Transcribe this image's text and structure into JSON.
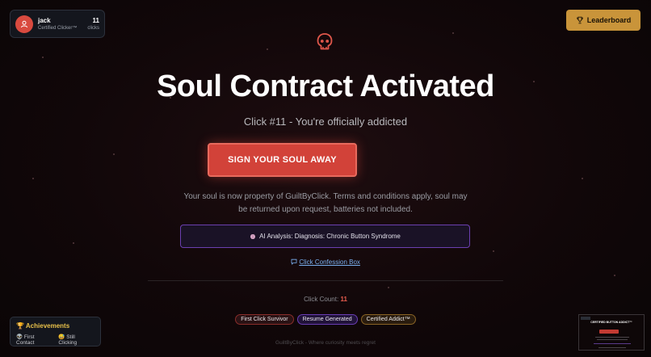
{
  "user": {
    "name": "jack",
    "title": "Certified Clicker™",
    "clicks": "11",
    "clicks_label": "clicks"
  },
  "leaderboard": {
    "label": "Leaderboard"
  },
  "main": {
    "headline": "Soul Contract Activated",
    "subline": "Click #11 - You're officially addicted",
    "cta_label": "SIGN YOUR SOUL AWAY",
    "description": "Your soul is now property of GuiltByClick. Terms and conditions apply, soul may be returned upon request, batteries not included.",
    "ai_analysis": "AI Analysis: Diagnosis: Chronic Button Syndrome",
    "confession_link": "Click Confession Box",
    "count_label": "Click Count:",
    "count_value": "11",
    "badges": [
      "First Click Survivor",
      "Resume Generated",
      "Certified Addict™"
    ],
    "footer": "GuiltByClick - Where curiosity meets regret"
  },
  "achievements": {
    "title": "Achievements",
    "items": [
      "First Contact",
      "Still Clicking"
    ]
  },
  "thumbnail": {
    "title": "CERTIFIED BUTTON ADDICT™"
  },
  "colors": {
    "accent_red": "#d24239",
    "gold": "#c9943a",
    "purple": "#6b3fb0",
    "link_blue": "#7ab0f0"
  },
  "icons": {
    "avatar": "user-icon",
    "leaderboard": "trophy-icon",
    "hero": "skull-icon",
    "ai": "brain-icon",
    "confession": "chat-bubble-icon"
  }
}
